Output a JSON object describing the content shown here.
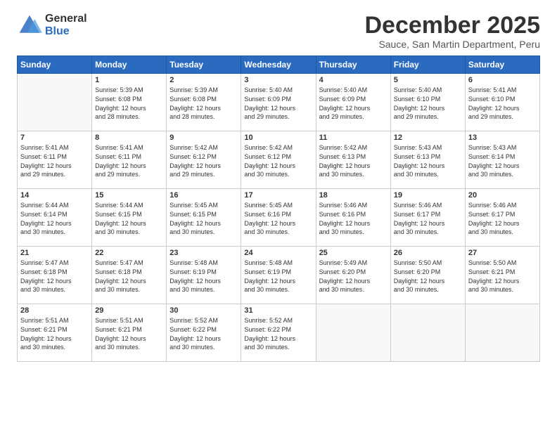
{
  "logo": {
    "general": "General",
    "blue": "Blue"
  },
  "header": {
    "month": "December 2025",
    "location": "Sauce, San Martin Department, Peru"
  },
  "weekdays": [
    "Sunday",
    "Monday",
    "Tuesday",
    "Wednesday",
    "Thursday",
    "Friday",
    "Saturday"
  ],
  "weeks": [
    [
      {
        "day": "",
        "info": ""
      },
      {
        "day": "1",
        "info": "Sunrise: 5:39 AM\nSunset: 6:08 PM\nDaylight: 12 hours\nand 28 minutes."
      },
      {
        "day": "2",
        "info": "Sunrise: 5:39 AM\nSunset: 6:08 PM\nDaylight: 12 hours\nand 28 minutes."
      },
      {
        "day": "3",
        "info": "Sunrise: 5:40 AM\nSunset: 6:09 PM\nDaylight: 12 hours\nand 29 minutes."
      },
      {
        "day": "4",
        "info": "Sunrise: 5:40 AM\nSunset: 6:09 PM\nDaylight: 12 hours\nand 29 minutes."
      },
      {
        "day": "5",
        "info": "Sunrise: 5:40 AM\nSunset: 6:10 PM\nDaylight: 12 hours\nand 29 minutes."
      },
      {
        "day": "6",
        "info": "Sunrise: 5:41 AM\nSunset: 6:10 PM\nDaylight: 12 hours\nand 29 minutes."
      }
    ],
    [
      {
        "day": "7",
        "info": "Sunrise: 5:41 AM\nSunset: 6:11 PM\nDaylight: 12 hours\nand 29 minutes."
      },
      {
        "day": "8",
        "info": "Sunrise: 5:41 AM\nSunset: 6:11 PM\nDaylight: 12 hours\nand 29 minutes."
      },
      {
        "day": "9",
        "info": "Sunrise: 5:42 AM\nSunset: 6:12 PM\nDaylight: 12 hours\nand 29 minutes."
      },
      {
        "day": "10",
        "info": "Sunrise: 5:42 AM\nSunset: 6:12 PM\nDaylight: 12 hours\nand 30 minutes."
      },
      {
        "day": "11",
        "info": "Sunrise: 5:42 AM\nSunset: 6:13 PM\nDaylight: 12 hours\nand 30 minutes."
      },
      {
        "day": "12",
        "info": "Sunrise: 5:43 AM\nSunset: 6:13 PM\nDaylight: 12 hours\nand 30 minutes."
      },
      {
        "day": "13",
        "info": "Sunrise: 5:43 AM\nSunset: 6:14 PM\nDaylight: 12 hours\nand 30 minutes."
      }
    ],
    [
      {
        "day": "14",
        "info": "Sunrise: 5:44 AM\nSunset: 6:14 PM\nDaylight: 12 hours\nand 30 minutes."
      },
      {
        "day": "15",
        "info": "Sunrise: 5:44 AM\nSunset: 6:15 PM\nDaylight: 12 hours\nand 30 minutes."
      },
      {
        "day": "16",
        "info": "Sunrise: 5:45 AM\nSunset: 6:15 PM\nDaylight: 12 hours\nand 30 minutes."
      },
      {
        "day": "17",
        "info": "Sunrise: 5:45 AM\nSunset: 6:16 PM\nDaylight: 12 hours\nand 30 minutes."
      },
      {
        "day": "18",
        "info": "Sunrise: 5:46 AM\nSunset: 6:16 PM\nDaylight: 12 hours\nand 30 minutes."
      },
      {
        "day": "19",
        "info": "Sunrise: 5:46 AM\nSunset: 6:17 PM\nDaylight: 12 hours\nand 30 minutes."
      },
      {
        "day": "20",
        "info": "Sunrise: 5:46 AM\nSunset: 6:17 PM\nDaylight: 12 hours\nand 30 minutes."
      }
    ],
    [
      {
        "day": "21",
        "info": "Sunrise: 5:47 AM\nSunset: 6:18 PM\nDaylight: 12 hours\nand 30 minutes."
      },
      {
        "day": "22",
        "info": "Sunrise: 5:47 AM\nSunset: 6:18 PM\nDaylight: 12 hours\nand 30 minutes."
      },
      {
        "day": "23",
        "info": "Sunrise: 5:48 AM\nSunset: 6:19 PM\nDaylight: 12 hours\nand 30 minutes."
      },
      {
        "day": "24",
        "info": "Sunrise: 5:48 AM\nSunset: 6:19 PM\nDaylight: 12 hours\nand 30 minutes."
      },
      {
        "day": "25",
        "info": "Sunrise: 5:49 AM\nSunset: 6:20 PM\nDaylight: 12 hours\nand 30 minutes."
      },
      {
        "day": "26",
        "info": "Sunrise: 5:50 AM\nSunset: 6:20 PM\nDaylight: 12 hours\nand 30 minutes."
      },
      {
        "day": "27",
        "info": "Sunrise: 5:50 AM\nSunset: 6:21 PM\nDaylight: 12 hours\nand 30 minutes."
      }
    ],
    [
      {
        "day": "28",
        "info": "Sunrise: 5:51 AM\nSunset: 6:21 PM\nDaylight: 12 hours\nand 30 minutes."
      },
      {
        "day": "29",
        "info": "Sunrise: 5:51 AM\nSunset: 6:21 PM\nDaylight: 12 hours\nand 30 minutes."
      },
      {
        "day": "30",
        "info": "Sunrise: 5:52 AM\nSunset: 6:22 PM\nDaylight: 12 hours\nand 30 minutes."
      },
      {
        "day": "31",
        "info": "Sunrise: 5:52 AM\nSunset: 6:22 PM\nDaylight: 12 hours\nand 30 minutes."
      },
      {
        "day": "",
        "info": ""
      },
      {
        "day": "",
        "info": ""
      },
      {
        "day": "",
        "info": ""
      }
    ]
  ]
}
